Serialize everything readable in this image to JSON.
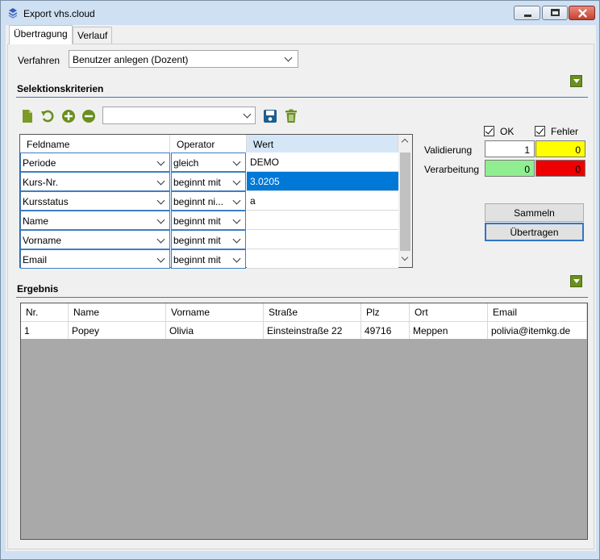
{
  "window": {
    "title": "Export vhs.cloud"
  },
  "tabs": [
    {
      "label": "Übertragung"
    },
    {
      "label": "Verlauf"
    }
  ],
  "verfahren": {
    "label": "Verfahren",
    "value": "Benutzer anlegen (Dozent)"
  },
  "selection": {
    "title": "Selektionskriterien",
    "toolbar": {
      "preset_value": ""
    },
    "columns": [
      "Feldname",
      "Operator",
      "Wert"
    ],
    "rows": [
      {
        "field": "Periode",
        "operator": "gleich",
        "value": "DEMO"
      },
      {
        "field": "Kurs-Nr.",
        "operator": "beginnt mit",
        "value": "3.0205"
      },
      {
        "field": "Kursstatus",
        "operator": "beginnt ni...",
        "value": "a"
      },
      {
        "field": "Name",
        "operator": "beginnt mit",
        "value": ""
      },
      {
        "field": "Vorname",
        "operator": "beginnt mit",
        "value": ""
      },
      {
        "field": "Email",
        "operator": "beginnt mit",
        "value": ""
      }
    ]
  },
  "status": {
    "ok_label": "OK",
    "error_label": "Fehler",
    "validation_label": "Validierung",
    "processing_label": "Verarbeitung",
    "validation_ok": "1",
    "validation_error": "0",
    "processing_ok": "0",
    "processing_error": "0",
    "colors": {
      "neutral": "#ffffff",
      "yellow": "#ffff00",
      "green": "#90ee90",
      "red": "#ee0000"
    }
  },
  "buttons": {
    "collect": "Sammeln",
    "transfer": "Übertragen"
  },
  "result": {
    "title": "Ergebnis",
    "columns": [
      "Nr.",
      "Name",
      "Vorname",
      "Straße",
      "Plz",
      "Ort",
      "Email"
    ],
    "rows": [
      [
        "1",
        "Popey",
        "Olivia",
        "Einsteinstraße 22",
        "49716",
        "Meppen",
        "polivia@itemkg.de"
      ]
    ]
  }
}
